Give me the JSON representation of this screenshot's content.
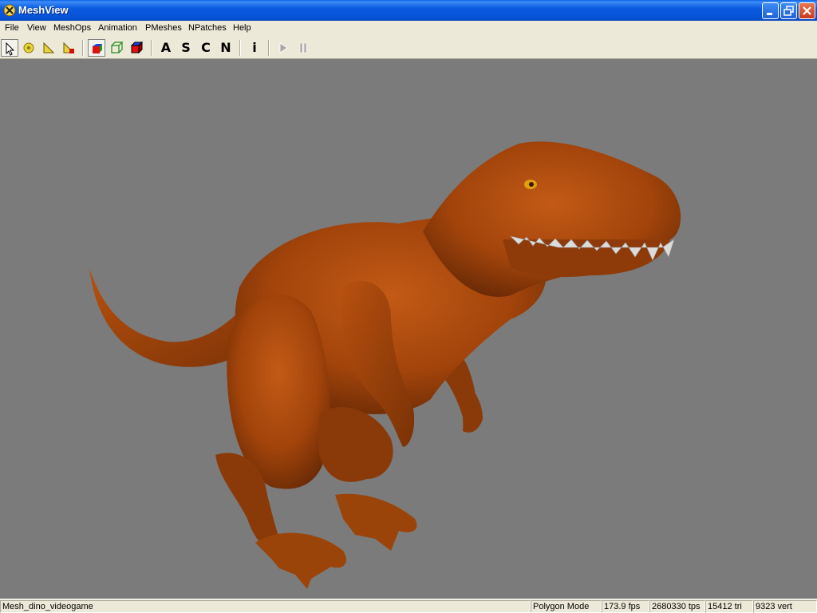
{
  "window": {
    "title": "MeshView",
    "icon": "meshview-app-icon"
  },
  "menu": [
    "File",
    "View",
    "MeshOps",
    "Animation",
    "PMeshes",
    "NPatches",
    "Help"
  ],
  "toolbar": {
    "letters": [
      "A",
      "S",
      "C",
      "N",
      "i"
    ],
    "icons": [
      "select-arrow-icon",
      "rotate-tool-icon",
      "translate-tool-icon",
      "scale-tool-icon",
      "solid-cube-icon",
      "wireframe-cube-icon",
      "textured-cube-icon",
      "play-icon",
      "pause-icon"
    ]
  },
  "viewport": {
    "background": "#7b7b7b",
    "model": "dinosaur"
  },
  "status": {
    "mesh_name": "Mesh_dino_videogame",
    "mode": "Polygon Mode",
    "fps": "173.9 fps",
    "tps": "2680330 tps",
    "tri": "15412 tri",
    "vert": "9323 vert"
  }
}
